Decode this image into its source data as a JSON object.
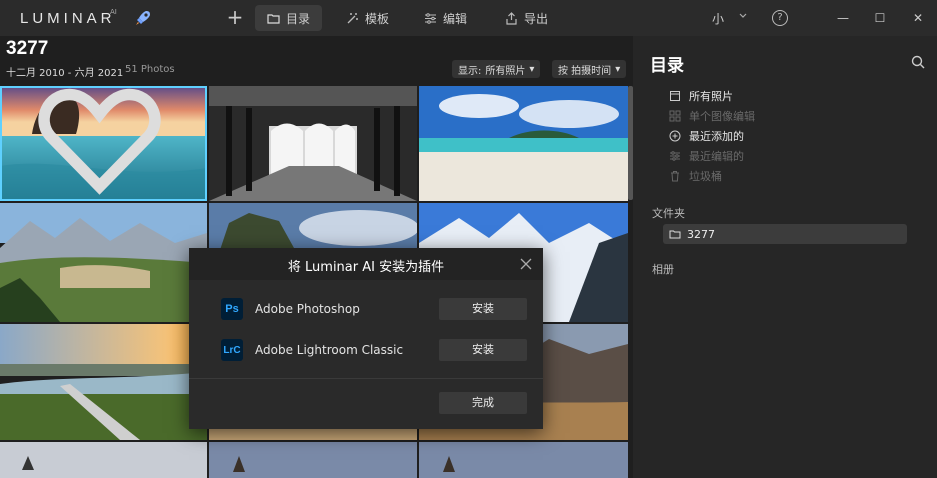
{
  "app": {
    "logo_text": "LUMINAR",
    "version": "AI",
    "rocket_icon": "rocket-icon"
  },
  "toolbar": {
    "tabs": [
      {
        "label": "目录",
        "icon": "catalog-folder-icon",
        "active": true
      },
      {
        "label": "模板",
        "icon": "magic-wand-icon",
        "active": false
      },
      {
        "label": "编辑",
        "icon": "sliders-icon",
        "active": false
      },
      {
        "label": "导出",
        "icon": "export-icon",
        "active": false
      }
    ],
    "zoom_label": "小",
    "help_label": "?"
  },
  "album": {
    "title": "3277",
    "date_range": "十二月 2010 - 六月 2021",
    "count": "51 Photos",
    "display_label": "显示:",
    "display_value": "所有照片",
    "sort_label": "按 拍摄时间"
  },
  "sidebar": {
    "title": "目录",
    "items": [
      {
        "label": "所有照片",
        "icon": "photos-icon",
        "enabled": true
      },
      {
        "label": "单个图像编辑",
        "icon": "grid-icon",
        "enabled": false
      },
      {
        "label": "最近添加的",
        "icon": "plus-circle-icon",
        "enabled": true
      },
      {
        "label": "最近编辑的",
        "icon": "sliders-icon",
        "enabled": false
      },
      {
        "label": "垃圾桶",
        "icon": "trash-icon",
        "enabled": false
      }
    ],
    "folders_label": "文件夹",
    "folder_name": "3277",
    "albums_label": "相册"
  },
  "dialog": {
    "title": "将 Luminar AI 安装为插件",
    "apps": [
      {
        "badge": "Ps",
        "name": "Adobe Photoshop",
        "button": "安装",
        "badge_color": "#31a8ff",
        "badge_bg": "#001e36"
      },
      {
        "badge": "LrC",
        "name": "Adobe Lightroom Classic",
        "button": "安装",
        "badge_color": "#31a8ff",
        "badge_bg": "#001e36"
      }
    ],
    "done_label": "完成"
  },
  "colors": {
    "selection": "#5fd0ff",
    "sidebar_bg": "#262626",
    "titlebar_bg": "#2b2b2b"
  }
}
